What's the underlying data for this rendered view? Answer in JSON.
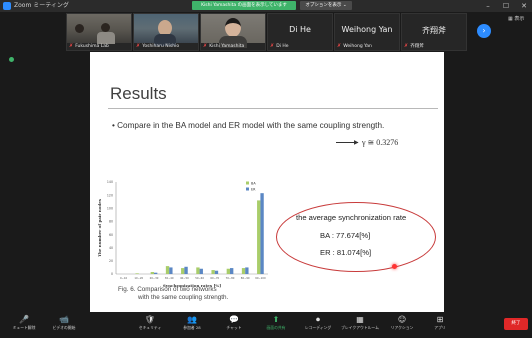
{
  "window": {
    "app_title": "Zoom ミーティング",
    "share_banner": "Kishi Yamashita の画面を表示しています",
    "options_button": "オプションを表示 ⌄",
    "minimize": "–",
    "maximize": "☐",
    "close": "✕"
  },
  "gallery": {
    "tiles": [
      {
        "name": "Fukushima Lab",
        "kind": "video"
      },
      {
        "name": "Yoshiharu Nishio",
        "kind": "video"
      },
      {
        "name": "Kishi Yamashita",
        "kind": "video"
      },
      {
        "name": "Di He",
        "kind": "name"
      },
      {
        "name": "Weihong Yan",
        "kind": "name"
      },
      {
        "name": "齐翔斧",
        "kind": "name"
      }
    ],
    "view_toggle": "▦ 表示"
  },
  "slide": {
    "title": "Results",
    "bullet": "• Compare in the BA model and ER model with the same coupling strength.",
    "gamma": "γ ≅ 0.3276",
    "figure_caption_line1": "Fig. 6. Comparison of two networks",
    "figure_caption_line2": "with the same coupling strength.",
    "rate_title": "the average synchronization rate",
    "rate_ba": "BA : 77.674[%]",
    "rate_er": "ER : 81.074[%]"
  },
  "chart_data": {
    "type": "bar",
    "title": "",
    "xlabel": "Synchronization rates [%]",
    "ylabel": "The number of pair nodes",
    "ylim": [
      0,
      140
    ],
    "yticks": [
      0,
      20,
      40,
      60,
      80,
      100,
      120,
      140
    ],
    "categories": [
      "0~10",
      "10~20",
      "20~30",
      "30~40",
      "40~50",
      "50~60",
      "60~70",
      "70~80",
      "80~90",
      "90~100"
    ],
    "series": [
      {
        "name": "BA",
        "color": "#a9cd6a",
        "values": [
          0,
          1,
          3,
          12,
          9,
          10,
          6,
          8,
          9,
          112
        ]
      },
      {
        "name": "ER",
        "color": "#5b87c4",
        "values": [
          0,
          0,
          2,
          10,
          11,
          8,
          5,
          9,
          10,
          123
        ]
      }
    ],
    "legend_position": "top-right",
    "grid": false
  },
  "toolbar": {
    "items": [
      {
        "icon": "🎤",
        "label": "ミュート解除"
      },
      {
        "icon": "📹",
        "label": "ビデオの開始"
      },
      {
        "icon": "🛡",
        "label": "セキュリティ"
      },
      {
        "icon": "👥",
        "label": "参加者 28"
      },
      {
        "icon": "💬",
        "label": "チャット"
      },
      {
        "icon": "⬆",
        "label": "画面の共有"
      },
      {
        "icon": "⏺",
        "label": "レコーディング"
      },
      {
        "icon": "▦",
        "label": "ブレイクアウトルーム"
      },
      {
        "icon": "☺",
        "label": "リアクション"
      },
      {
        "icon": "⊞",
        "label": "アプリ"
      }
    ],
    "end_label": "終了"
  }
}
